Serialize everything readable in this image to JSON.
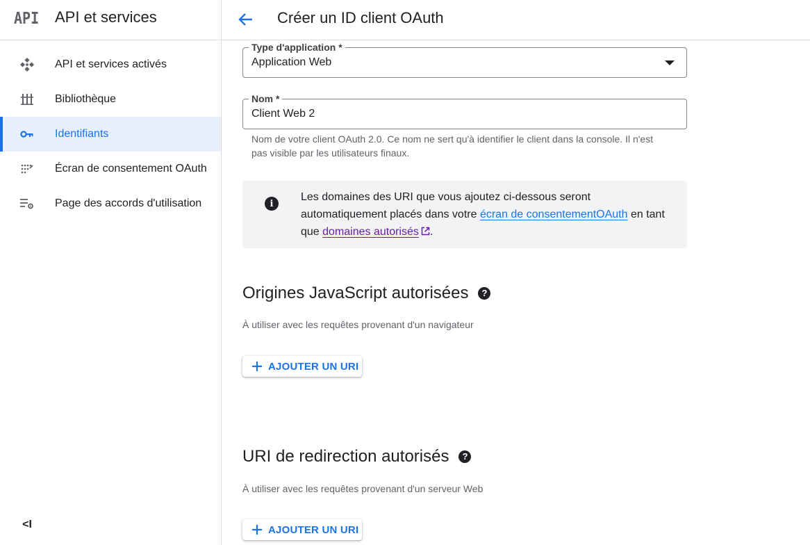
{
  "sidebar": {
    "logo": "API",
    "title": "API et services",
    "items": [
      {
        "label": "API et services activés",
        "icon": "api-diamond-icon"
      },
      {
        "label": "Bibliothèque",
        "icon": "library-icon"
      },
      {
        "label": "Identifiants",
        "icon": "key-icon",
        "active": true
      },
      {
        "label": "Écran de consentement OAuth",
        "icon": "consent-dots-icon"
      },
      {
        "label": "Page des accords d'utilisation",
        "icon": "settings-list-icon"
      }
    ],
    "collapse_label": "<I"
  },
  "header": {
    "title": "Créer un ID client OAuth"
  },
  "form": {
    "app_type": {
      "label": "Type d'application *",
      "value": "Application Web"
    },
    "name": {
      "label": "Nom *",
      "value": "Client Web 2",
      "hint": "Nom de votre client OAuth 2.0. Ce nom ne sert qu'à identifier le client dans la console. Il n'est pas visible par les utilisateurs finaux."
    },
    "info": {
      "text_1": "Les domaines des URI que vous ajoutez ci-dessous seront automatiquement placés dans votre ",
      "link_1": "écran de consentementOAuth",
      "text_2": " en tant que ",
      "link_2": "domaines autorisés",
      "text_3": "."
    },
    "js_origins": {
      "title": "Origines JavaScript autorisées",
      "desc": "À utiliser avec les requêtes provenant d'un navigateur",
      "button": "AJOUTER UN URI"
    },
    "redirect_uris": {
      "title": "URI de redirection autorisés",
      "desc": "À utiliser avec les requêtes provenant d'un serveur Web",
      "button": "AJOUTER UN URI"
    }
  },
  "colors": {
    "accent": "#1a73e8",
    "visited_link": "#681da8",
    "active_bg": "#e8f0fe",
    "info_bg": "#f1f3f4"
  }
}
